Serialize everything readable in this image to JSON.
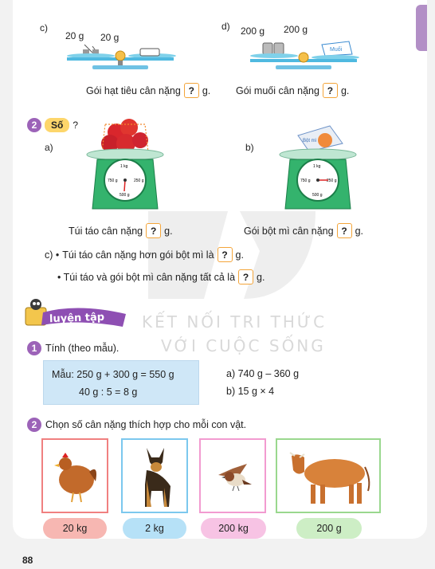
{
  "page_number": "88",
  "part_c": {
    "label": "c)",
    "weight_left": "20 g",
    "weight_right": "20 g",
    "sentence": "Gói hạt tiêu cân nặng",
    "unit": "g."
  },
  "part_d": {
    "label": "d)",
    "weight_left": "200 g",
    "weight_right": "200 g",
    "package_label": "Muối",
    "sentence": "Gói muối cân nặng",
    "unit": "g."
  },
  "question_mark": "?",
  "exercise2": {
    "number": "2",
    "tag": "Số",
    "suffix": "?",
    "a_label": "a)",
    "b_label": "b)",
    "scale_marks": [
      "1 kg",
      "750 g",
      "250 g",
      "500 g"
    ],
    "flour_label": "Bột mì",
    "a_sentence": "Túi táo cân nặng",
    "b_sentence": "Gói bột mì cân nặng",
    "unit": "g.",
    "c_label": "c) •",
    "c_line1": "Túi táo cân nặng hơn gói bột mì là",
    "c_line2": "• Túi táo và gói bột mì cân nặng tất cả là"
  },
  "practice": {
    "title": "luyện tập"
  },
  "watermark": {
    "line1": "KẾT NỐI TRI THỨC",
    "line2": "VỚI CUỘC SỐNG"
  },
  "task1": {
    "number": "1",
    "instruction": "Tính (theo mẫu).",
    "example_line1": "Mẫu: 250 g + 300 g = 550 g",
    "example_line2": "40 g : 5 = 8 g",
    "a": "a) 740 g – 360 g",
    "b": "b) 15 g × 4"
  },
  "task2": {
    "number": "2",
    "instruction": "Chọn số cân nặng thích hợp cho mỗi con vật.",
    "animals": [
      "hen",
      "dog",
      "sparrow",
      "cow"
    ],
    "options": [
      "20 kg",
      "2 kg",
      "200 kg",
      "200 g"
    ],
    "colors": {
      "red": "#f08080",
      "blue": "#7cc8ee",
      "pink": "#f29bd0",
      "green": "#9ad88e"
    }
  }
}
